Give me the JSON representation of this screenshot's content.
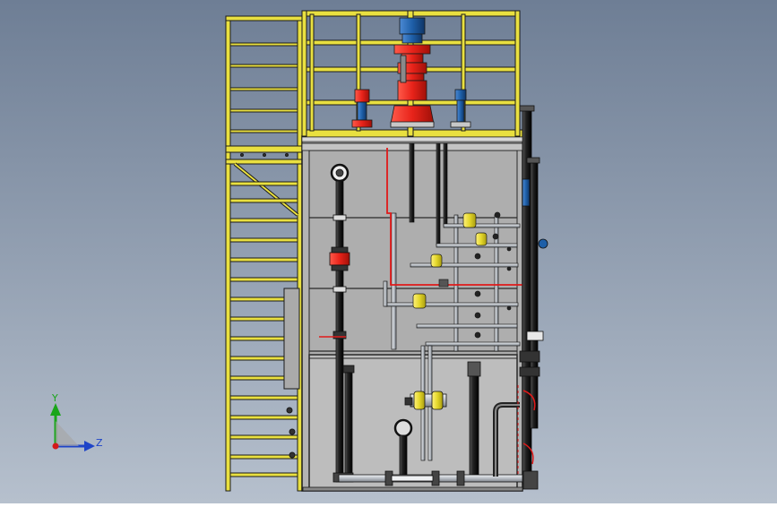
{
  "triad": {
    "y_label": "Y",
    "z_label": "Z"
  },
  "colors": {
    "background_top": "#6e7e95",
    "background_bottom": "#b6c0cd",
    "tank_fill": "#b3b3b3",
    "tank_lower_fill": "#bdbdbd",
    "frame": "#1a1a1a",
    "railing": "#e9e040",
    "pump": "#e8231a",
    "motor": "#1e5fa8",
    "pipe_dark": "#222222",
    "pipe_light": "#cfd3d8",
    "redline": "#e01a1a",
    "valve_yellow": "#e4d72a",
    "axis_y": "#1aa51a",
    "axis_z": "#1e44c8",
    "axis_origin": "#d31a1a"
  }
}
